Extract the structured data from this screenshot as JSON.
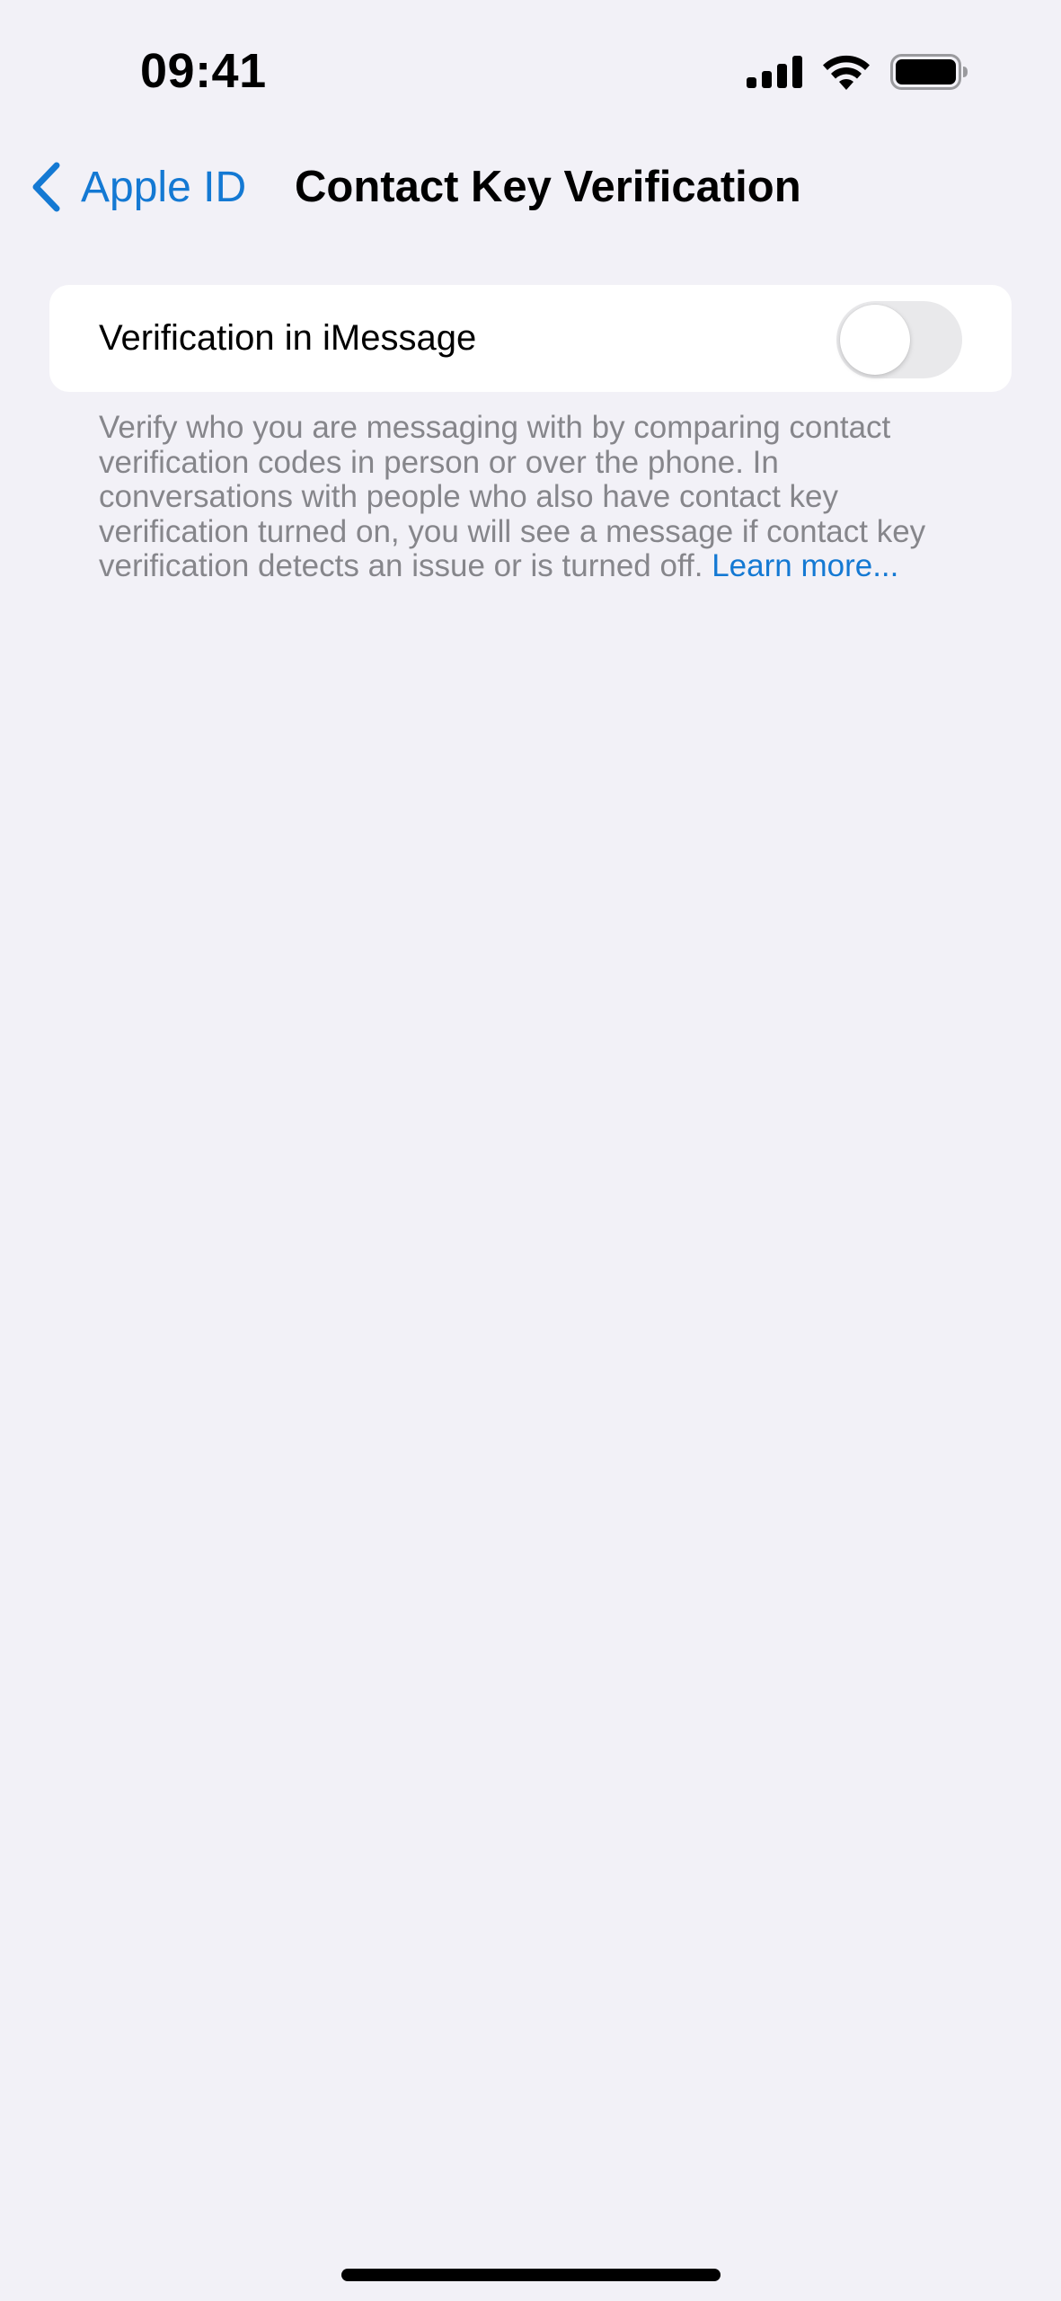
{
  "status_bar": {
    "time": "09:41",
    "icons": [
      "cellular-signal-icon",
      "wifi-icon",
      "battery-icon"
    ]
  },
  "nav": {
    "back_label": "Apple ID",
    "title": "Contact Key Verification"
  },
  "settings": {
    "toggle_label": "Verification in iMessage",
    "toggle_on": false,
    "footer_text": "Verify who you are messaging with by comparing contact verification codes in person or over the phone. In conversations with people who also have contact key verification turned on, you will see a message if contact key verification detects an issue or is turned off. ",
    "footer_link": "Learn more..."
  },
  "colors": {
    "background": "#f2f1f7",
    "accent": "#1479d3",
    "secondary_text": "#86868b",
    "toggle_off": "#e9e9eb"
  }
}
